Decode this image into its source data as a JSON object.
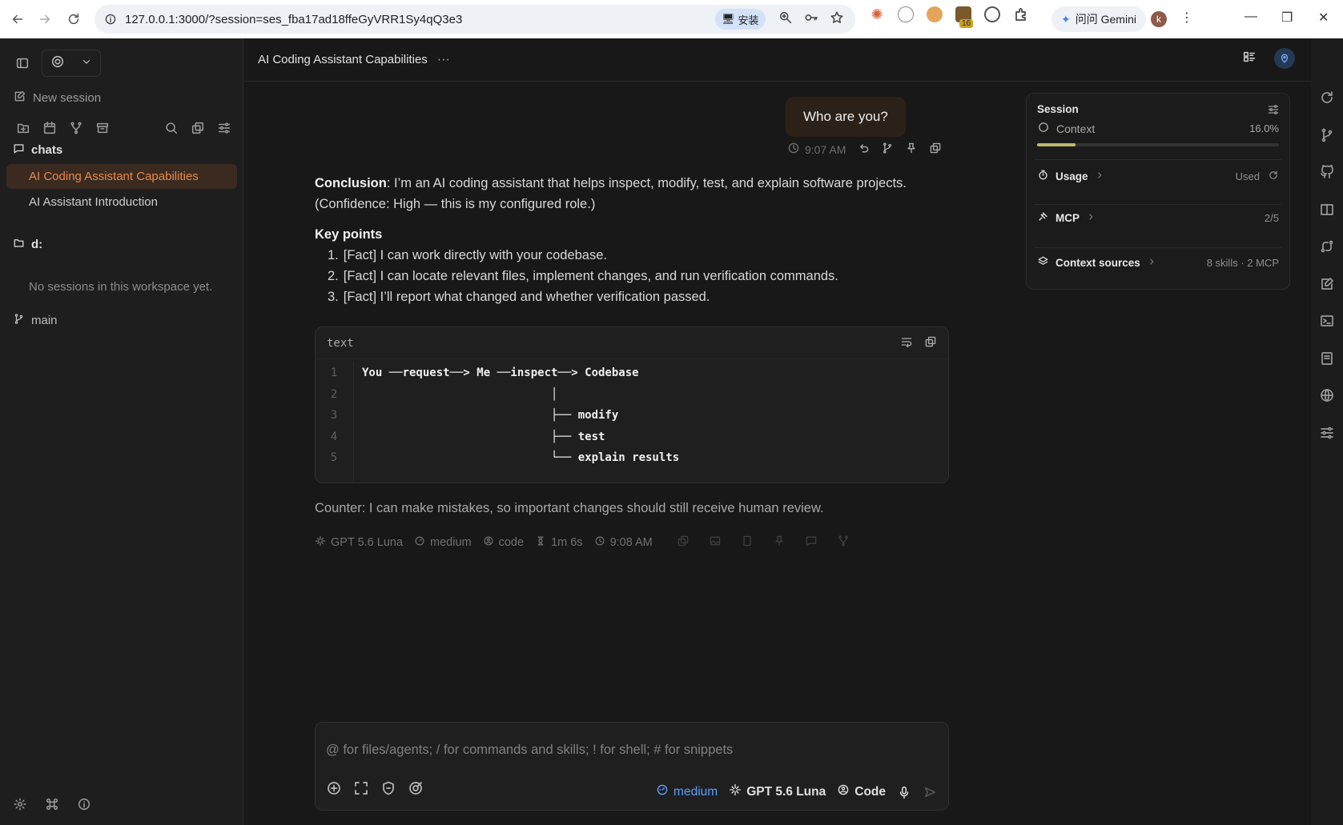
{
  "browser": {
    "url": "127.0.0.1:3000/?session=ses_fba17ad18ffeGyVRR1Sy4qQ3e3",
    "install_label": "安装",
    "gemini_label": "问问 Gemini",
    "profile_initial": "k",
    "ext_badge": "16"
  },
  "sidebar": {
    "new_session_label": "New session",
    "groups": [
      {
        "name": "chats",
        "sessions": [
          "AI Coding Assistant Capabilities",
          "AI Assistant Introduction"
        ]
      },
      {
        "name": "d:",
        "empty_text": "No sessions in this workspace yet."
      }
    ],
    "branch": "main"
  },
  "header": {
    "title": "AI Coding Assistant Capabilities",
    "more": "···"
  },
  "user_message": {
    "text": "Who are you?",
    "time": "9:07 AM"
  },
  "assistant": {
    "conclusion_label": "Conclusion",
    "conclusion_text": ": I’m an AI coding assistant that helps inspect, modify, test, and explain software projects. (Confidence: High — this is my configured role.)",
    "key_points_title": "Key points",
    "key_points": [
      {
        "num": "1.",
        "text": "[Fact] I can work directly with your codebase."
      },
      {
        "num": "2.",
        "text": "[Fact] I can locate relevant files, implement changes, and run verification commands."
      },
      {
        "num": "3.",
        "text": "[Fact] I’ll report what changed and whether verification passed."
      }
    ],
    "code": {
      "lang": "text",
      "lines": [
        {
          "n": "1",
          "text": "You ──request──> Me ──inspect──> Codebase"
        },
        {
          "n": "2",
          "text": "                            │"
        },
        {
          "n": "3",
          "text": "                            ├── modify"
        },
        {
          "n": "4",
          "text": "                            ├── test"
        },
        {
          "n": "5",
          "text": "                            └── explain results"
        }
      ]
    },
    "counter": "Counter: I can make mistakes, so important changes should still receive human review.",
    "meta": {
      "model": "GPT 5.6 Luna",
      "effort": "medium",
      "mode": "code",
      "duration": "1m 6s",
      "time": "9:08 AM"
    }
  },
  "session_panel": {
    "title": "Session",
    "context_label": "Context",
    "context_value": "16.0%",
    "context_fraction": 0.16,
    "usage_label": "Usage",
    "usage_value": "Used",
    "mcp_label": "MCP",
    "mcp_value": "2/5",
    "sources_label": "Context sources",
    "sources_value": "8 skills · 2 MCP"
  },
  "composer": {
    "placeholder": "@ for files/agents; / for commands and skills; ! for shell; # for snippets",
    "effort": "medium",
    "model": "GPT 5.6 Luna",
    "mode": "Code"
  },
  "colors": {
    "accent": "#e88a4a",
    "active_bg": "#3a2a20",
    "user_bubble": "#2c2118",
    "progress": "#bdb76b",
    "link_blue": "#5aa0ff"
  }
}
